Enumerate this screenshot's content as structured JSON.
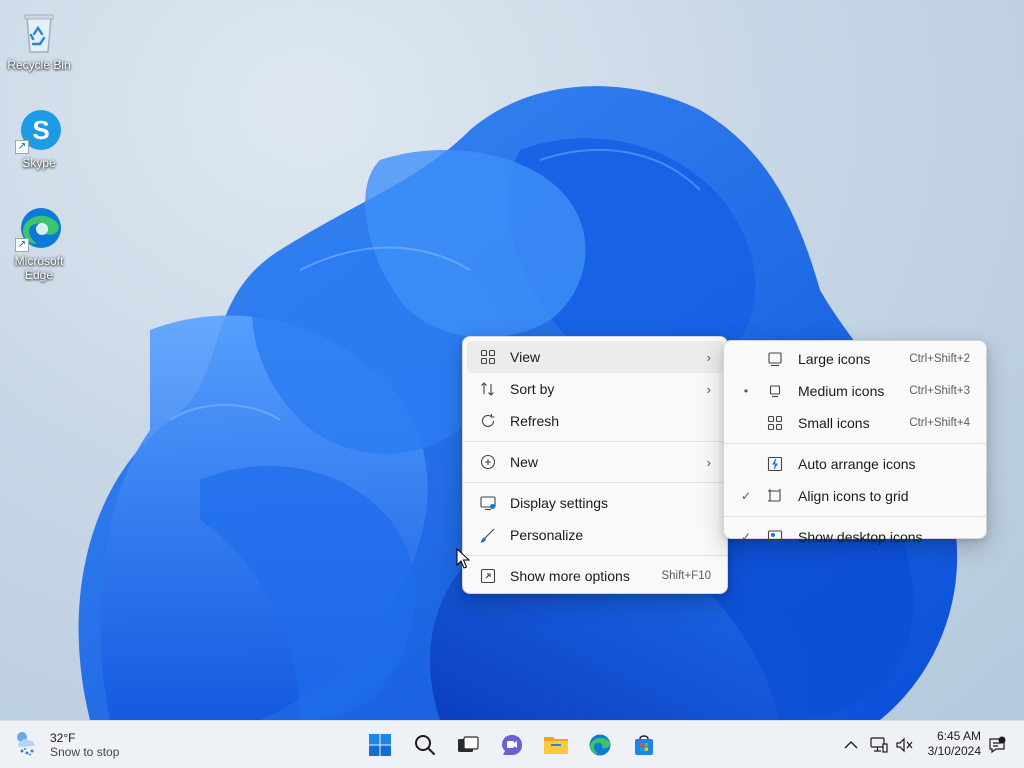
{
  "desktop": {
    "icons": [
      {
        "label": "Recycle Bin",
        "icon": "recycle-bin-icon"
      },
      {
        "label": "Skype",
        "icon": "skype-icon"
      },
      {
        "label": "Microsoft Edge",
        "icon": "edge-icon"
      }
    ]
  },
  "context_menu": {
    "items": [
      {
        "label": "View",
        "icon": "grid-icon",
        "has_submenu": true
      },
      {
        "label": "Sort by",
        "icon": "sort-icon",
        "has_submenu": true
      },
      {
        "label": "Refresh",
        "icon": "refresh-icon"
      },
      {
        "label": "New",
        "icon": "plus-circle-icon",
        "has_submenu": true
      },
      {
        "label": "Display settings",
        "icon": "display-icon"
      },
      {
        "label": "Personalize",
        "icon": "brush-icon"
      },
      {
        "label": "Show more options",
        "icon": "more-options-icon",
        "shortcut": "Shift+F10"
      }
    ]
  },
  "view_submenu": {
    "items": [
      {
        "label": "Large icons",
        "shortcut": "Ctrl+Shift+2",
        "checked": false,
        "icon": "large-icons-icon"
      },
      {
        "label": "Medium icons",
        "shortcut": "Ctrl+Shift+3",
        "selected_mark": "•",
        "icon": "medium-icons-icon"
      },
      {
        "label": "Small icons",
        "shortcut": "Ctrl+Shift+4",
        "icon": "small-icons-icon"
      },
      {
        "label": "Auto arrange icons",
        "icon": "auto-arrange-icon"
      },
      {
        "label": "Align icons to grid",
        "check_mark": "✓",
        "icon": "align-grid-icon"
      },
      {
        "label": "Show desktop icons",
        "check_mark": "✓",
        "icon": "show-desktop-icon"
      }
    ]
  },
  "taskbar": {
    "weather": {
      "temp": "32°F",
      "condition": "Snow to stop",
      "icon": "snow-cloud-icon"
    },
    "apps": [
      "start-icon",
      "search-icon",
      "task-view-icon",
      "chat-icon",
      "file-explorer-icon",
      "edge-icon",
      "store-icon"
    ],
    "tray": [
      "chevron-up-icon",
      "network-icon",
      "volume-muted-icon",
      "notifications-icon"
    ],
    "clock": {
      "time": "6:45 AM",
      "date": "3/10/2024"
    }
  },
  "colors": {
    "accent": "#0067c0",
    "wallpaper_blue": "#1a6fe8",
    "menu_bg": "#f9f9f9",
    "taskbar_bg": "#eef2f6"
  }
}
